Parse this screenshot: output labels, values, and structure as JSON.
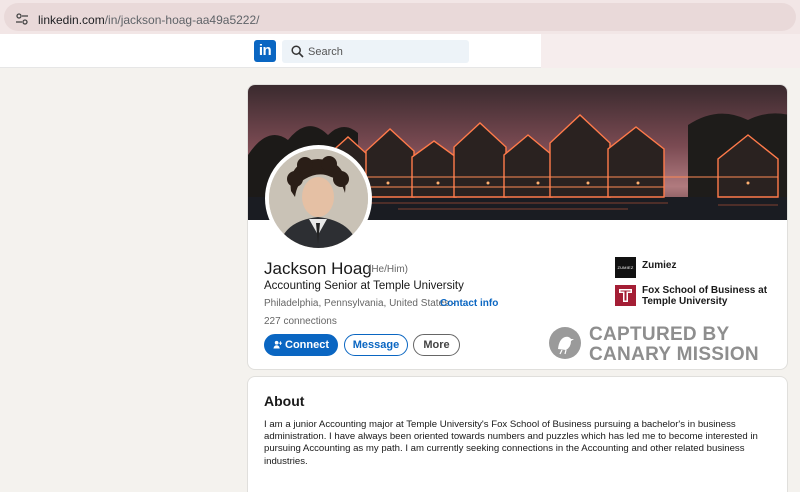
{
  "browser": {
    "url_domain": "linkedin.com",
    "url_path": "/in/jackson-hoag-aa49a5222/"
  },
  "nav": {
    "logo_text": "in",
    "search_placeholder": "Search"
  },
  "profile": {
    "name": "Jackson Hoag",
    "pronouns": "(He/Him)",
    "headline": "Accounting Senior at Temple University",
    "location": "Philadelphia, Pennsylvania, United States",
    "separator": " · ",
    "contact_info_label": "Contact info",
    "connections": "227 connections",
    "buttons": {
      "connect": "Connect",
      "message": "Message",
      "more": "More"
    },
    "experience": [
      {
        "name": "Zumiez",
        "logo": "zumiez-logo",
        "logo_text": "ZUMIEZ"
      },
      {
        "name": "Fox School of Business at Temple University",
        "line1": "Fox School of Business at",
        "line2": "Temple University",
        "logo": "temple-t-logo"
      }
    ]
  },
  "watermark": {
    "line1": "CAPTURED BY",
    "line2": "CANARY MISSION"
  },
  "about": {
    "title": "About",
    "text": "I am a junior Accounting major at Temple University's Fox School of Business pursuing a bachelor's in business administration. I have always been oriented towards numbers and puzzles which has led me to become interested in pursuing Accounting as my path. I am currently seeking connections in the Accounting and other related business industries."
  },
  "colors": {
    "linkedin_blue": "#0a66c2",
    "temple_cherry": "#a41e35",
    "page_bg": "#f4f2ee"
  }
}
